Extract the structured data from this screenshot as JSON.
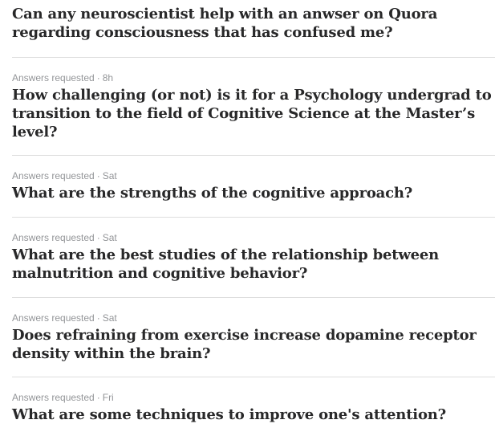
{
  "feed": {
    "items": [
      {
        "meta_label": "",
        "meta_time": "",
        "question": "Can any neuroscientist help with an anwser on Quora regarding consciousness that has confused me?"
      },
      {
        "meta_label": "Answers requested",
        "meta_time": "8h",
        "question": "How challenging (or not) is it for a Psychology undergrad to transition to the field of Cognitive Science at the Master’s level?"
      },
      {
        "meta_label": "Answers requested",
        "meta_time": "Sat",
        "question": "What are the strengths of the cognitive approach?"
      },
      {
        "meta_label": "Answers requested",
        "meta_time": "Sat",
        "question": "What are the best studies of the relationship between malnutrition and cognitive behavior?"
      },
      {
        "meta_label": "Answers requested",
        "meta_time": "Sat",
        "question": "Does refraining from exercise increase dopamine receptor density within the brain?"
      },
      {
        "meta_label": "Answers requested",
        "meta_time": "Fri",
        "question": "What are some techniques to improve one's attention?"
      }
    ],
    "separator": "·"
  },
  "colors": {
    "title": "#282829",
    "meta": "#939598",
    "divider": "#dedede",
    "background": "#ffffff"
  }
}
